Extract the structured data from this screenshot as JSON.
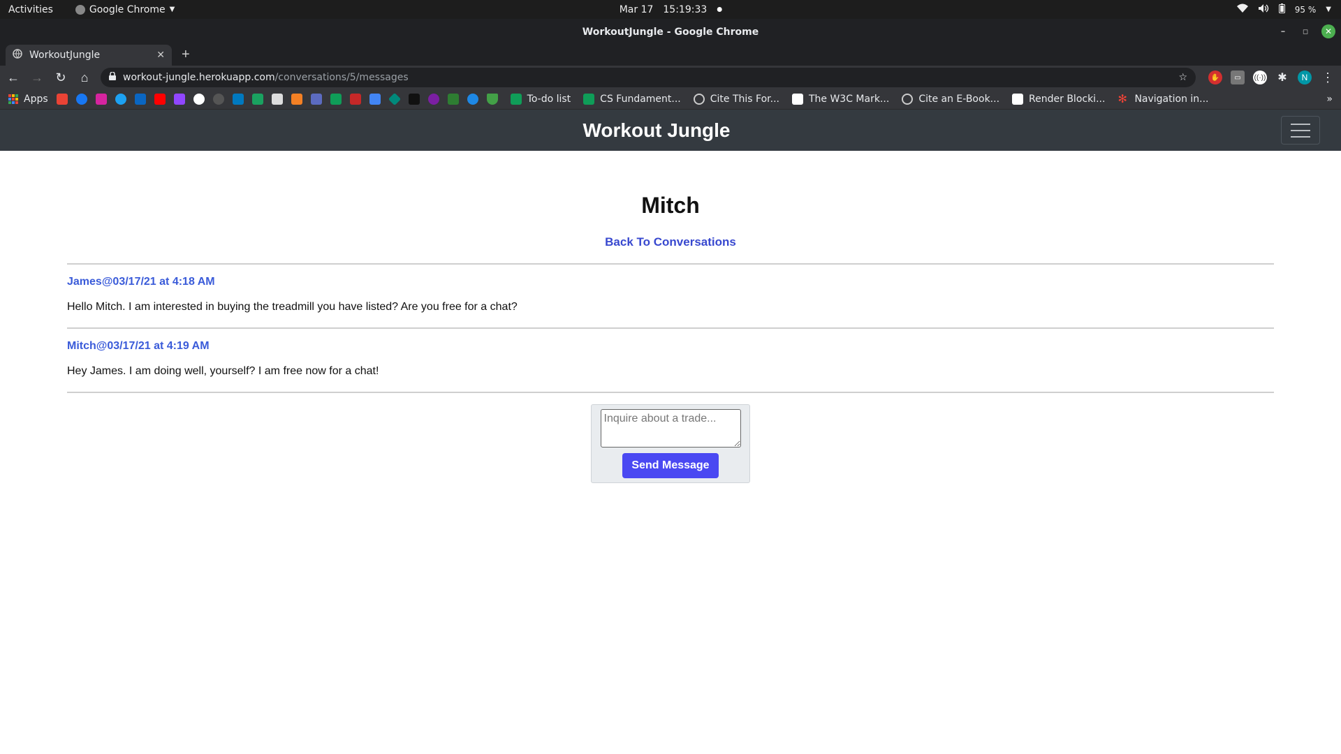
{
  "os": {
    "activities": "Activities",
    "app_name": "Google Chrome",
    "date": "Mar 17",
    "time": "15:19:33",
    "battery": "95 %"
  },
  "window": {
    "title": "WorkoutJungle - Google Chrome"
  },
  "tab": {
    "title": "WorkoutJungle"
  },
  "omnibox": {
    "host": "workout-jungle.herokuapp.com",
    "path": "/conversations/5/messages"
  },
  "bookmarks": {
    "apps": "Apps",
    "items": [
      "To-do list",
      "CS Fundament...",
      "Cite This For...",
      "The W3C Mark...",
      "Cite an E-Book...",
      "Render Blocki...",
      "Navigation in..."
    ],
    "more": "»"
  },
  "site": {
    "brand": "Workout Jungle"
  },
  "page": {
    "title": "Mitch",
    "back_link": "Back To Conversations"
  },
  "messages": [
    {
      "author_line": "James@03/17/21 at 4:18 AM",
      "body": "Hello Mitch. I am interested in buying the treadmill you have listed? Are you free for a chat?"
    },
    {
      "author_line": "Mitch@03/17/21 at 4:19 AM",
      "body": "Hey James. I am doing well, yourself? I am free now for a chat!"
    }
  ],
  "compose": {
    "placeholder": "Inquire about a trade...",
    "send_label": "Send Message"
  },
  "profile_initial": "N",
  "colors": {
    "navbar_bg": "#343a40",
    "link_blue": "#3848cf",
    "author_blue": "#3a5bd9",
    "button_bg": "#4a48f2",
    "compose_bg": "#e9ecef"
  }
}
